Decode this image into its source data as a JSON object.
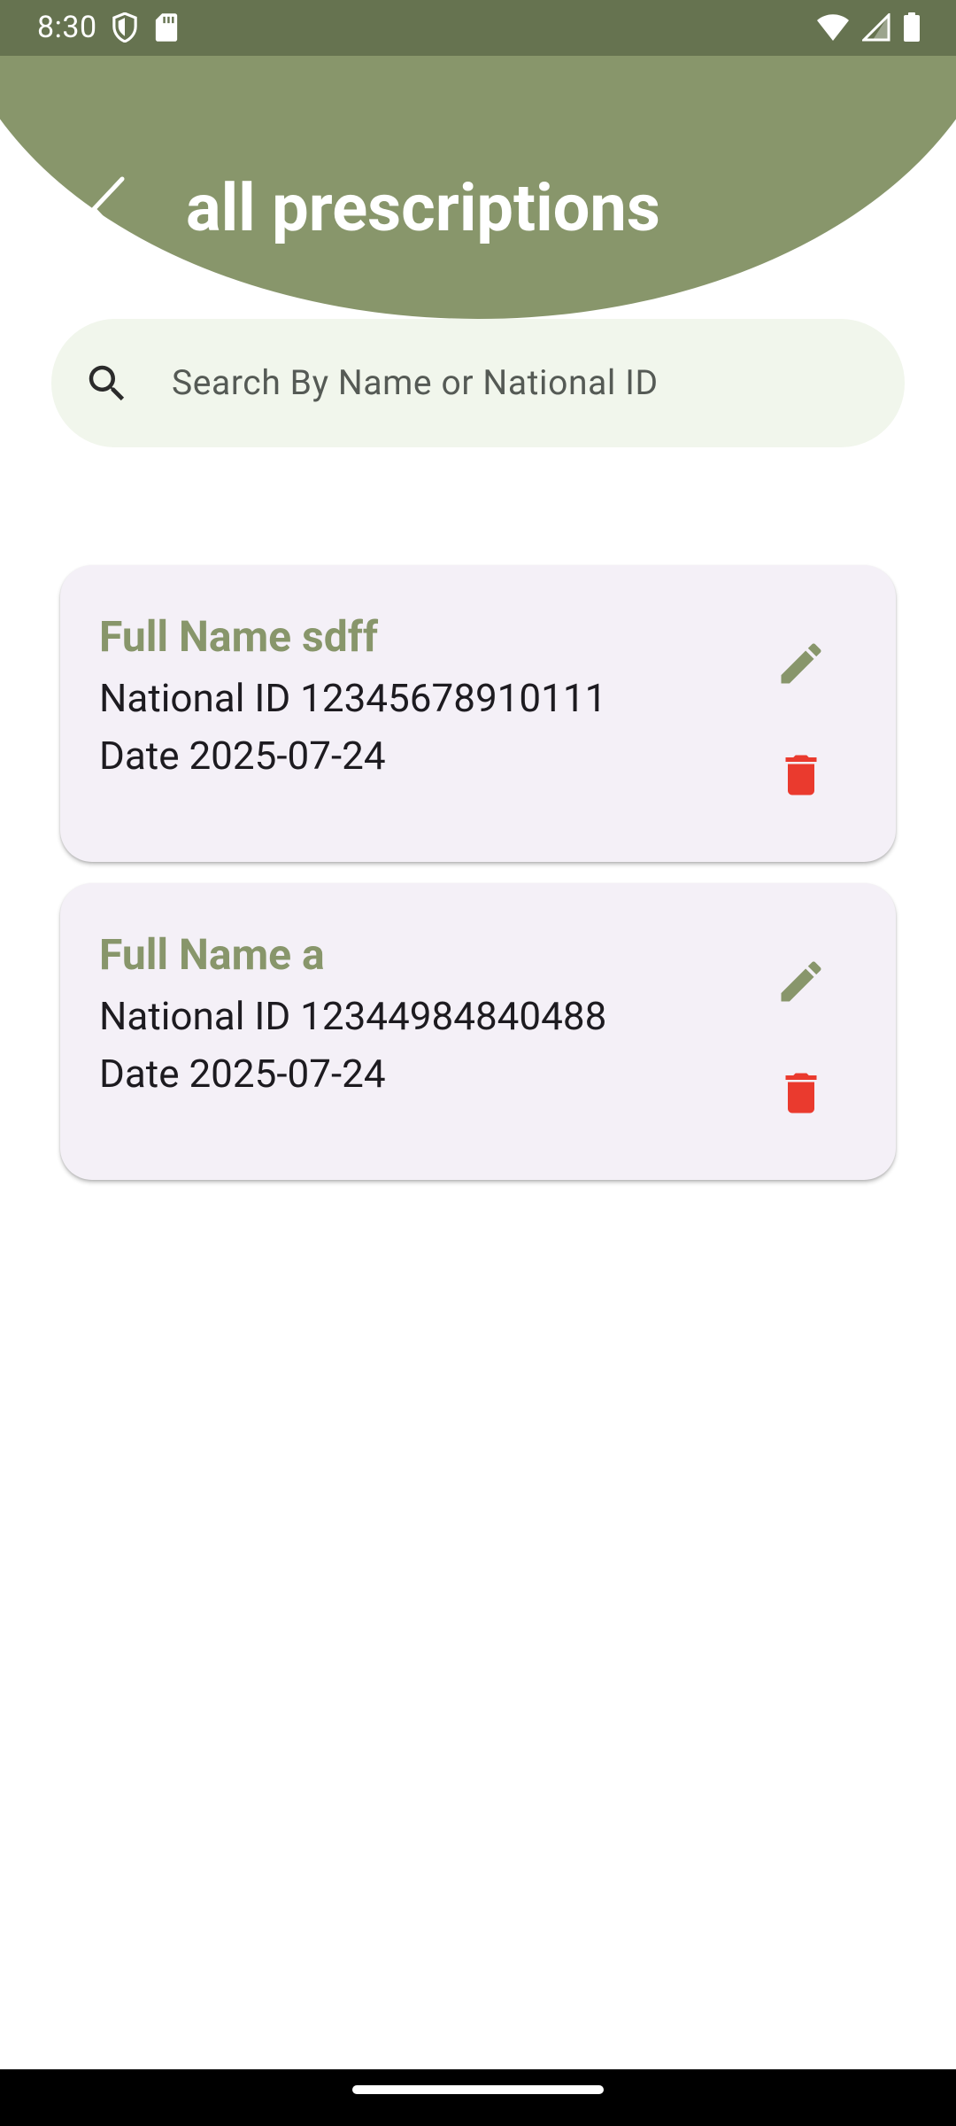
{
  "status_bar": {
    "time": "8:30",
    "left_icons": [
      "shield-icon",
      "sd-card-icon"
    ],
    "right_icons": [
      "wifi-icon",
      "signal-icon",
      "battery-icon"
    ]
  },
  "header": {
    "title": "all prescriptions",
    "back_icon": "chevron-left-icon",
    "color": "#88966b"
  },
  "search": {
    "placeholder": "Search By Name or National ID",
    "value": "",
    "icon": "search-icon"
  },
  "prescriptions": [
    {
      "name": "Full Name sdff",
      "national_id": "National ID 12345678910111",
      "date": "Date 2025-07-24"
    },
    {
      "name": "Full Name a",
      "national_id": "National ID 12344984840488",
      "date": "Date 2025-07-24"
    }
  ],
  "colors": {
    "accent": "#88966b",
    "status_bar": "#667350",
    "delete": "#ea3a2e",
    "card_background": "#f4f0f7",
    "search_background": "#f1f6ec"
  }
}
